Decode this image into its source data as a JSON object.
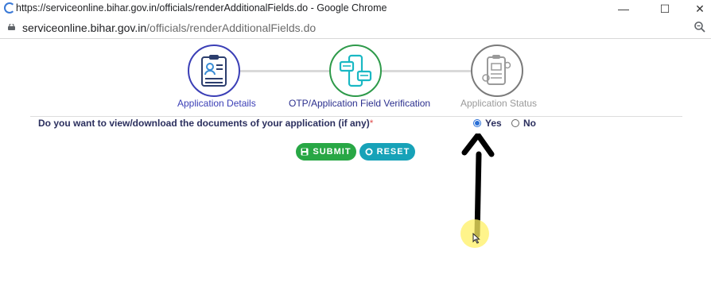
{
  "browser": {
    "window_title": "https://serviceonline.bihar.gov.in/officials/renderAdditionalFields.do - Google Chrome",
    "url_host": "serviceonline.bihar.gov.in",
    "url_path": "/officials/renderAdditionalFields.do",
    "controls": {
      "minimize": "—",
      "maximize": "☐",
      "close": "✕"
    }
  },
  "steps": [
    {
      "label": "Application Details",
      "color": "#3b3fb6",
      "state": "done"
    },
    {
      "label": "OTP/Application Field Verification",
      "color": "#2e9a4a",
      "state": "active"
    },
    {
      "label": "Application Status",
      "color": "#8a8a8a",
      "state": "pending"
    }
  ],
  "form": {
    "question": "Do you want to view/download the documents of your application (if any)",
    "required_marker": "*",
    "options": [
      {
        "label": "Yes",
        "checked": true
      },
      {
        "label": "No",
        "checked": false
      }
    ],
    "submit_label": "SUBMIT",
    "reset_label": "RESET"
  },
  "colors": {
    "submit": "#28a745",
    "reset": "#17a2b8",
    "question_text": "#2b2f5e"
  }
}
